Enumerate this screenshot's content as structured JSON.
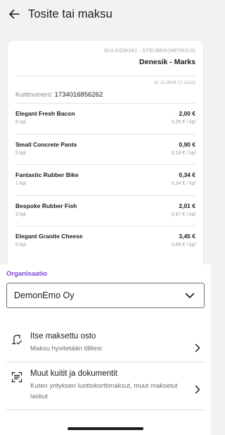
{
  "header": {
    "title": "Tosite tai maksu",
    "back_icon": "arrow-left-icon"
  },
  "receipt": {
    "merchant_sub": "GULGOWSKI - STEUBER(METRICS)",
    "merchant_name": "Denesik - Marks",
    "timestamp": "12.12.2024 17.13.02",
    "receipt_no_label": "Kuittinumero:",
    "receipt_no": "1734016856262",
    "items": [
      {
        "name": "Elegant Fresh Bacon",
        "qty": "8 kpl",
        "total": "2,00 €",
        "unit": "0,25 € / kpl"
      },
      {
        "name": "Small Concrete Pants",
        "qty": "5 kpl",
        "total": "0,90 €",
        "unit": "0,18 € / kpl"
      },
      {
        "name": "Fantastic Rubber Bike",
        "qty": "1 kpl",
        "total": "0,34 €",
        "unit": "0,34 € / kpl"
      },
      {
        "name": "Bespoke Rubber Fish",
        "qty": "3 kpl",
        "total": "2,01 €",
        "unit": "0,67 € / kpl"
      },
      {
        "name": "Elegant Granite Cheese",
        "qty": "5 kpl",
        "total": "3,45 €",
        "unit": "0,69 € / kpl"
      }
    ]
  },
  "organization": {
    "label": "Organisaatio",
    "selected": "DemonEmo Oy",
    "dropdown_icon": "chevron-down-icon",
    "label_color": "#7b45d1"
  },
  "options": [
    {
      "title": "Itse maksettu osto",
      "description": "Maksu hyvitetään tilillesi",
      "icon": "receipt-arrow-icon"
    },
    {
      "title": "Muut kuitit ja dokumentit",
      "description": "Kuten yrityksen luottokorttimaksut, muut maksetut laskut",
      "icon": "document-scan-icon"
    }
  ]
}
